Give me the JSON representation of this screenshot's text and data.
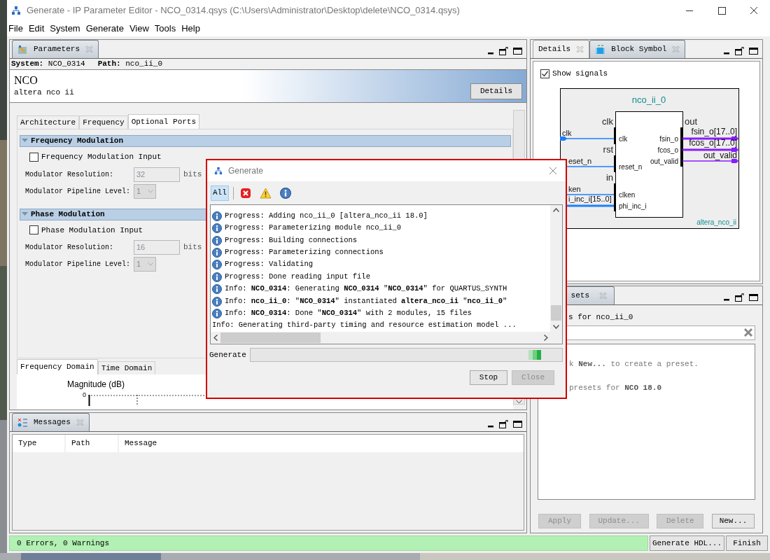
{
  "window": {
    "title": "Generate - IP Parameter Editor - NCO_0314.qsys (C:\\Users\\Administrator\\Desktop\\delete\\NCO_0314.qsys)"
  },
  "menu": [
    "File",
    "Edit",
    "System",
    "Generate",
    "View",
    "Tools",
    "Help"
  ],
  "parameters_panel": {
    "tab": "Parameters",
    "system_label": "System:",
    "system": "NCO_0314",
    "path_label": "Path:",
    "path": "nco_ii_0",
    "component_title": "NCO",
    "component_name": "altera nco ii",
    "details_button": "Details",
    "tabs": [
      {
        "label": "Architecture",
        "selected": false
      },
      {
        "label": "Frequency",
        "selected": false
      },
      {
        "label": "Optional Ports",
        "selected": true
      }
    ],
    "sections": [
      {
        "title": "Frequency Modulation",
        "expanded": true,
        "input": {
          "label": "Frequency Modulation Input",
          "checked": false
        },
        "resolution_label": "Modulator Resolution:",
        "resolution": "32",
        "unit": "bits",
        "pipeline_label": "Modulator Pipeline Level:",
        "pipeline": "1",
        "fields_disabled": true
      },
      {
        "title": "Phase Modulation",
        "expanded": true,
        "input": {
          "label": "Phase Modulation Input",
          "checked": false
        },
        "resolution_label": "Modulator Resolution:",
        "resolution": "16",
        "unit": "bits",
        "pipeline_label": "Modulator Pipeline Level:",
        "pipeline": "1",
        "fields_disabled": true
      }
    ],
    "view_tabs": [
      {
        "label": "Frequency Domain",
        "selected": true
      },
      {
        "label": "Time Domain",
        "selected": false
      }
    ],
    "plot_title": "Magnitude (dB)",
    "plot_tick": "0"
  },
  "messages_panel": {
    "tab": "Messages",
    "columns": [
      "Type",
      "Path",
      "Message"
    ]
  },
  "block_symbol_panel": {
    "tabs": [
      {
        "label": "Details",
        "selected": false
      },
      {
        "label": "Block Symbol",
        "selected": true
      }
    ],
    "show_signals": {
      "label": "Show signals",
      "checked": true
    },
    "symbol": {
      "instance": "nco_ii_0",
      "component": "altera_nco_ii",
      "input_groups": [
        {
          "label": "clk",
          "signals": [
            {
              "signal": "clk",
              "port": "clk",
              "bus": false
            }
          ]
        },
        {
          "label": "rst",
          "signals": [
            {
              "signal": "eset_n",
              "port": "reset_n",
              "bus": false
            }
          ]
        },
        {
          "label": "in",
          "signals": [
            {
              "signal": "ken",
              "port": "clken",
              "bus": false
            },
            {
              "signal": "i_inc_i[15..0]",
              "port": "phi_inc_i",
              "bus": true
            }
          ]
        }
      ],
      "output_groups": [
        {
          "label": "out",
          "signals": [
            {
              "signal": "fsin_o[17..0]",
              "port": "fsin_o",
              "bus": true
            },
            {
              "signal": "fcos_o[17..0]",
              "port": "fcos_o",
              "bus": true
            },
            {
              "signal": "out_valid",
              "port": "out_valid",
              "bus": false
            }
          ]
        }
      ]
    }
  },
  "presets_panel": {
    "tab": "sets",
    "heading": "s for nco_ii_0",
    "items": [
      "k **New...** to create a preset.",
      "presets for **NCO 18.0**"
    ],
    "buttons": [
      {
        "label": "Apply",
        "disabled": true
      },
      {
        "label": "Update...",
        "disabled": true
      },
      {
        "label": "Delete",
        "disabled": true
      },
      {
        "label": "New...",
        "disabled": false
      }
    ]
  },
  "status_bar": {
    "text": "0 Errors, 0 Warnings",
    "buttons": [
      "Generate HDL...",
      "Finish"
    ]
  },
  "dialog": {
    "title": "Generate",
    "filters": [
      {
        "kind": "all",
        "label": "All",
        "selected": true
      },
      {
        "kind": "error",
        "selected": false
      },
      {
        "kind": "warning",
        "selected": false
      },
      {
        "kind": "info",
        "selected": false
      }
    ],
    "log": [
      {
        "kind": "info",
        "text": "Progress: Adding nco_ii_0 [altera_nco_ii 18.0]"
      },
      {
        "kind": "info",
        "text": "Progress: Parameterizing module nco_ii_0"
      },
      {
        "kind": "info",
        "text": "Progress: Building connections"
      },
      {
        "kind": "info",
        "text": "Progress: Parameterizing connections"
      },
      {
        "kind": "info",
        "text": "Progress: Validating"
      },
      {
        "kind": "info",
        "text": "Progress: Done reading input file"
      },
      {
        "kind": "info",
        "text": "Info: **NCO_0314**: Generating **NCO_0314** \"**NCO_0314**\" for QUARTUS_SYNTH"
      },
      {
        "kind": "info",
        "text": "Info: **nco_ii_0**: \"**NCO_0314**\" instantiated **altera_nco_ii** \"**nco_ii_0**\""
      },
      {
        "kind": "info",
        "text": "Info: **NCO_0314**: Done \"**NCO_0314**\" with 2 modules, 15 files"
      },
      {
        "kind": "plain",
        "text": "Info: Generating third-party timing and resource estimation model ..."
      }
    ],
    "progress_label": "Generate",
    "progress_busy": true,
    "buttons": [
      {
        "label": "Stop",
        "disabled": false
      },
      {
        "label": "Close",
        "disabled": true
      }
    ]
  }
}
